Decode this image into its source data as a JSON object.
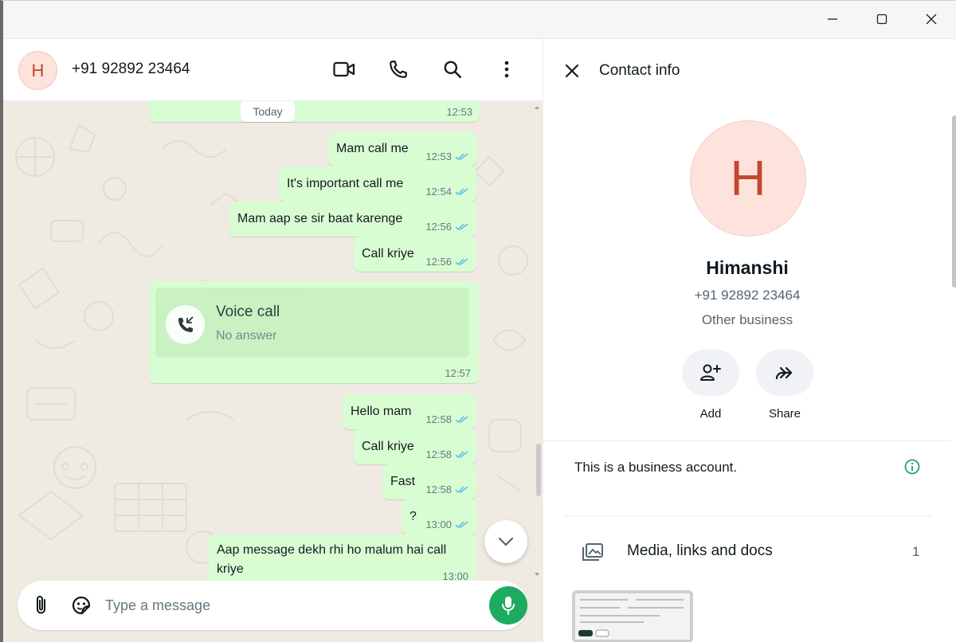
{
  "chat": {
    "contact_initial": "H",
    "title": "+91 92892 23464",
    "date_chip": "Today",
    "messages": [
      {
        "text": "",
        "time": "12:53"
      },
      {
        "text": "Mam call me",
        "time": "12:53"
      },
      {
        "text": "It's important call me",
        "time": "12:54"
      },
      {
        "text": "Mam aap se sir baat karenge",
        "time": "12:56"
      },
      {
        "text": "Call kriye",
        "time": "12:56"
      },
      {
        "text": "Hello mam",
        "time": "12:58"
      },
      {
        "text": "Call kriye",
        "time": "12:58"
      },
      {
        "text": "Fast",
        "time": "12:58"
      },
      {
        "text": "?",
        "time": "13:00"
      },
      {
        "text": "Aap message dekh rhi ho malum hai call kriye",
        "line1": "Aap message dekh rhi ho malum hai call",
        "line2": "kriye",
        "time": "13:00"
      }
    ],
    "voice_call": {
      "title": "Voice call",
      "status": "No answer",
      "time": "12:57"
    },
    "compose_placeholder": "Type a message"
  },
  "contact_info": {
    "header_title": "Contact info",
    "initial": "H",
    "name": "Himanshi",
    "phone": "+91 92892 23464",
    "type": "Other business",
    "actions": [
      {
        "label": "Add"
      },
      {
        "label": "Share"
      }
    ],
    "business_note": "This is a business account.",
    "media": {
      "label": "Media, links and docs",
      "count": "1"
    }
  },
  "colors": {
    "accent_green": "#1daa61",
    "bubble_out": "#d9fdd3",
    "avatar_bg": "#fde3dc",
    "avatar_fg": "#c4482b",
    "read_tick": "#53bdeb"
  },
  "icons": [
    "video-call-icon",
    "phone-icon",
    "search-icon",
    "menu-dots-icon",
    "close-icon",
    "add-user-icon",
    "share-icon",
    "info-icon",
    "media-icon",
    "attach-icon",
    "sticker-icon",
    "mic-icon",
    "chevron-down-icon"
  ]
}
